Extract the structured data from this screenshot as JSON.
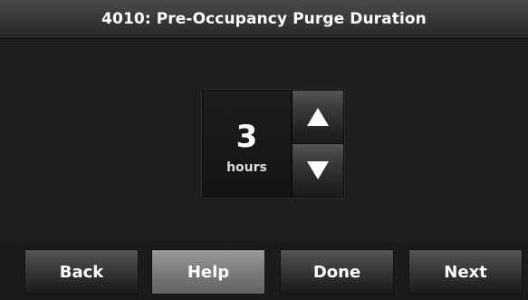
{
  "header": {
    "title": "4010: Pre-Occupancy Purge Duration"
  },
  "setting": {
    "value": "3",
    "unit": "hours",
    "increase_icon": "triangle-up-icon",
    "decrease_icon": "triangle-down-icon"
  },
  "footer": {
    "back_label": "Back",
    "help_label": "Help",
    "done_label": "Done",
    "next_label": "Next"
  },
  "colors": {
    "background": "#1e1e1e",
    "title_bar": "#3a3a3a",
    "button": "#3c3c3c",
    "help_button": "#7e7e7e",
    "text": "#ffffff"
  }
}
